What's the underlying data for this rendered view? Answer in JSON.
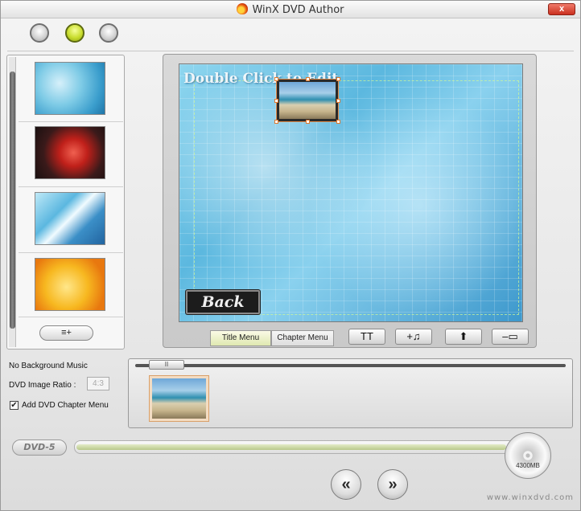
{
  "window": {
    "title": "WinX DVD Author",
    "close_label": "x"
  },
  "toolbar": {
    "buttons": [
      {
        "name": "step-1",
        "active": false
      },
      {
        "name": "step-2",
        "active": true
      },
      {
        "name": "step-3",
        "active": false
      }
    ]
  },
  "backgrounds": {
    "thumbnails": [
      "blue-crystal",
      "red-roses",
      "blue-wave",
      "yellow-bubbles"
    ],
    "add_menu_icon": "≡+"
  },
  "preview": {
    "title_text": "Double Click to Edit",
    "back_button_label": "Back"
  },
  "preview_toolbar": {
    "tabs": [
      {
        "label": "Title Menu",
        "active": true
      },
      {
        "label": "Chapter Menu",
        "active": false
      }
    ],
    "text_button": "TT",
    "music_button": "+♫",
    "up_button": "⬆",
    "remove_button": "–▭"
  },
  "options": {
    "music_label": "No Background Music",
    "ratio_label": "DVD Image Ratio :",
    "ratio_value": "4:3",
    "chapter_menu_label": "Add DVD Chapter Menu",
    "chapter_menu_checked": "✔"
  },
  "timeline": {
    "handle_label": "II"
  },
  "bottom": {
    "dvd_type": "DVD-5",
    "capacity_label": "4300MB",
    "capacity_fraction": 0.93,
    "prev_label": "«",
    "next_label": "»",
    "watermark": "www.winxdvd.com"
  }
}
